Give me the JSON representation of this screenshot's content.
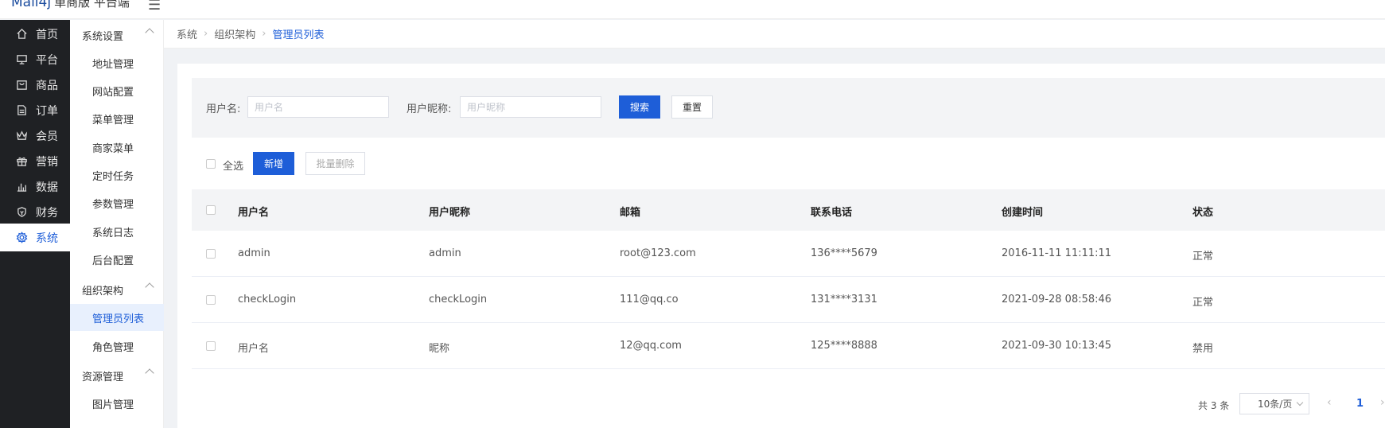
{
  "header": {
    "logo_main": "Mall4j",
    "logo_sub": "单商版 平台端"
  },
  "main_menu": [
    {
      "label": "首页",
      "icon": "home-icon"
    },
    {
      "label": "平台",
      "icon": "monitor-icon"
    },
    {
      "label": "商品",
      "icon": "bag-icon"
    },
    {
      "label": "订单",
      "icon": "document-icon"
    },
    {
      "label": "会员",
      "icon": "crown-icon"
    },
    {
      "label": "营销",
      "icon": "gift-icon"
    },
    {
      "label": "数据",
      "icon": "bar-chart-icon"
    },
    {
      "label": "财务",
      "icon": "shield-icon"
    },
    {
      "label": "系统",
      "icon": "gear-icon",
      "active": true
    }
  ],
  "sub_menu": {
    "groups": [
      {
        "label": "系统设置",
        "items": [
          "地址管理",
          "网站配置",
          "菜单管理",
          "商家菜单",
          "定时任务",
          "参数管理",
          "系统日志",
          "后台配置"
        ]
      },
      {
        "label": "组织架构",
        "items": [
          "管理员列表",
          "角色管理"
        ]
      },
      {
        "label": "资源管理",
        "items": [
          "图片管理"
        ]
      }
    ],
    "active_item": "管理员列表"
  },
  "breadcrumb": [
    "系统",
    "组织架构",
    "管理员列表"
  ],
  "search": {
    "username_label": "用户名:",
    "username_placeholder": "用户名",
    "nickname_label": "用户昵称:",
    "nickname_placeholder": "用户昵称",
    "search_button": "搜索",
    "reset_button": "重置"
  },
  "toolbar": {
    "select_all": "全选",
    "add_button": "新增",
    "batch_delete_button": "批量删除"
  },
  "table": {
    "columns": [
      "用户名",
      "用户昵称",
      "邮箱",
      "联系电话",
      "创建时间",
      "状态"
    ],
    "rows": [
      [
        "admin",
        "admin",
        "root@123.com",
        "136****5679",
        "2016-11-11 11:11:11",
        "正常"
      ],
      [
        "checkLogin",
        "checkLogin",
        "111@qq.co",
        "131****3131",
        "2021-09-28 08:58:46",
        "正常"
      ],
      [
        "用户名",
        "昵称",
        "12@qq.com",
        "125****8888",
        "2021-09-30 10:13:45",
        "禁用"
      ]
    ]
  },
  "pagination": {
    "total_text": "共 3 条",
    "page_size": "10条/页",
    "current_page": "1"
  },
  "colors": {
    "primary": "#1e5ed8",
    "sidebar_dark": "#1f2124"
  }
}
